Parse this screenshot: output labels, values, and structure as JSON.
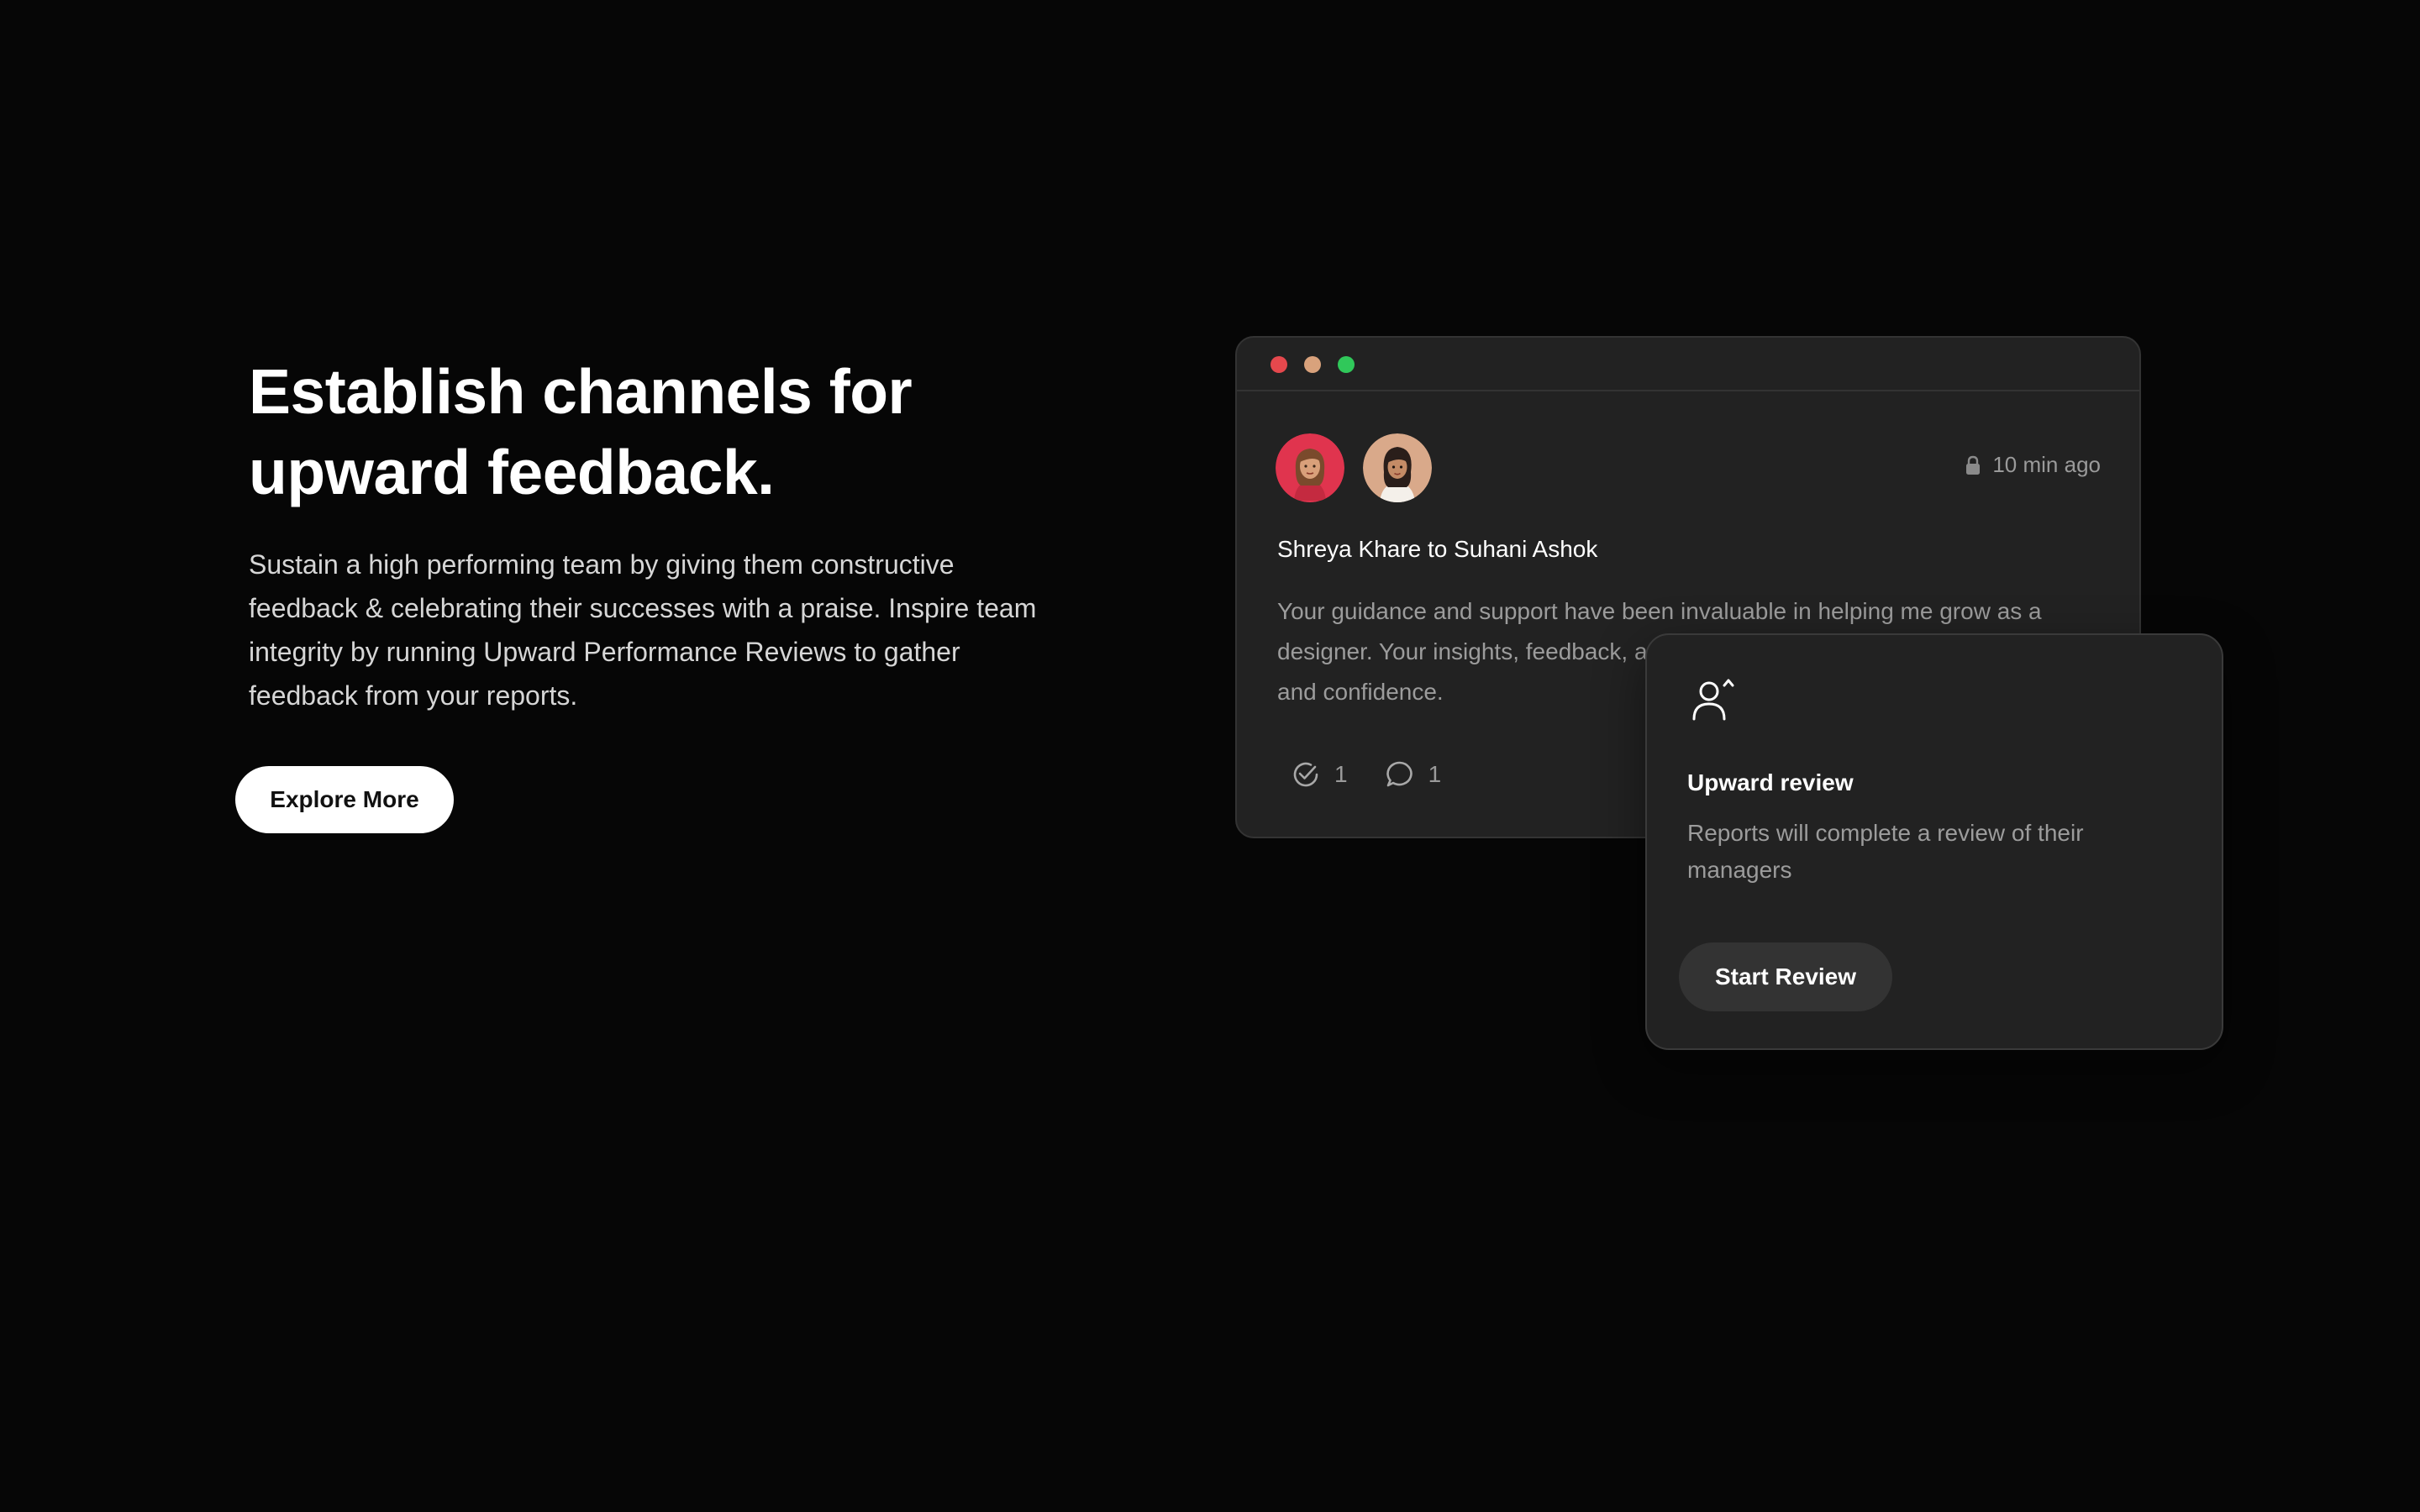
{
  "hero": {
    "title_line1": "Establish channels for",
    "title_line2": "upward feedback.",
    "description": "Sustain a high performing team by giving them constructive feedback & celebrating their successes with a praise. Inspire team integrity by running Upward Performance Reviews to gather feedback from your reports.",
    "explore_label": "Explore More"
  },
  "feedback_card": {
    "window_dots": [
      "#e5484d",
      "#d9a27c",
      "#30c85a"
    ],
    "avatars": [
      "avatar-shreya",
      "avatar-suhani"
    ],
    "timestamp": "10 min ago",
    "title": "Shreya Khare to Suhani Ashok",
    "body": "Your guidance and support have been invaluable in helping me grow as a designer. Your insights, feedback, and encouragement have boosted my skills and confidence.",
    "praise_count": "1",
    "comment_count": "1"
  },
  "review_card": {
    "icon": "person-up-icon",
    "title": "Upward review",
    "description": "Reports will complete a review of their managers",
    "button_label": "Start Review"
  },
  "colors": {
    "background": "#060606",
    "card": "#222222",
    "card_border": "#333333",
    "muted_text": "#9c9c9c"
  }
}
